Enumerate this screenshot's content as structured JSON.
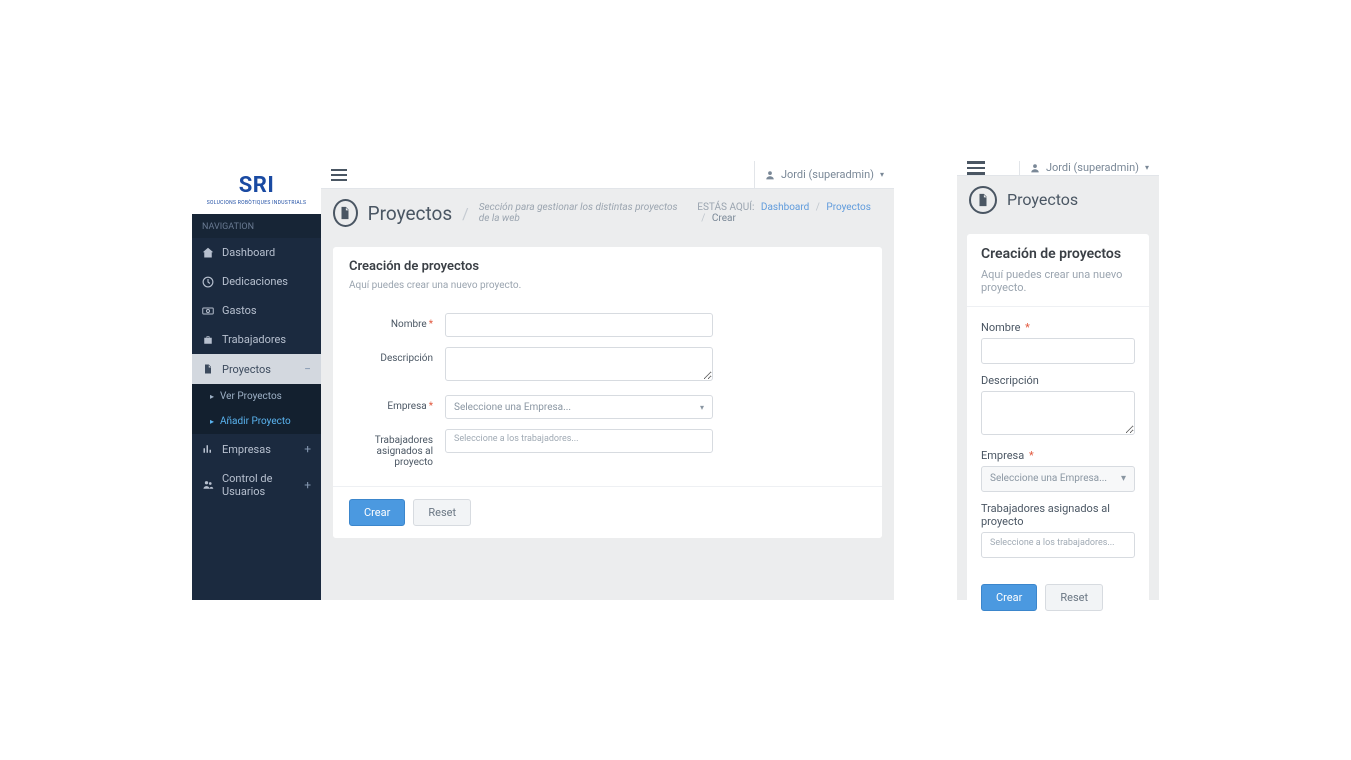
{
  "brand": {
    "name": "SRI",
    "tagline": "SOLUCIONS ROBÒTIQUES INDUSTRIALS"
  },
  "nav": {
    "section": "NAVIGATION",
    "items": [
      {
        "label": "Dashboard"
      },
      {
        "label": "Dedicaciones"
      },
      {
        "label": "Gastos"
      },
      {
        "label": "Trabajadores"
      },
      {
        "label": "Proyectos",
        "expanded": true,
        "sub": [
          {
            "label": "Ver Proyectos"
          },
          {
            "label": "Añadir Proyecto",
            "active": true
          }
        ]
      },
      {
        "label": "Empresas",
        "badge": "+"
      },
      {
        "label": "Control de Usuarios",
        "badge": "+"
      }
    ]
  },
  "user": {
    "display": "Jordi (superadmin)"
  },
  "page": {
    "title": "Proyectos",
    "subtitle": "Sección para gestionar los distintas proyectos de la web",
    "breadcrumb": {
      "label": "ESTÁS AQUÍ:",
      "items": [
        "Dashboard",
        "Proyectos"
      ],
      "current": "Crear"
    }
  },
  "form": {
    "card_title": "Creación de proyectos",
    "card_help": "Aquí puedes crear una nuevo proyecto.",
    "labels": {
      "nombre": "Nombre",
      "descripcion": "Descripción",
      "empresa": "Empresa",
      "trabajadores": "Trabajadores asignados al proyecto"
    },
    "placeholders": {
      "empresa": "Seleccione una Empresa...",
      "trabajadores": "Seleccione a los trabajadores..."
    },
    "buttons": {
      "create": "Crear",
      "reset": "Reset"
    }
  }
}
